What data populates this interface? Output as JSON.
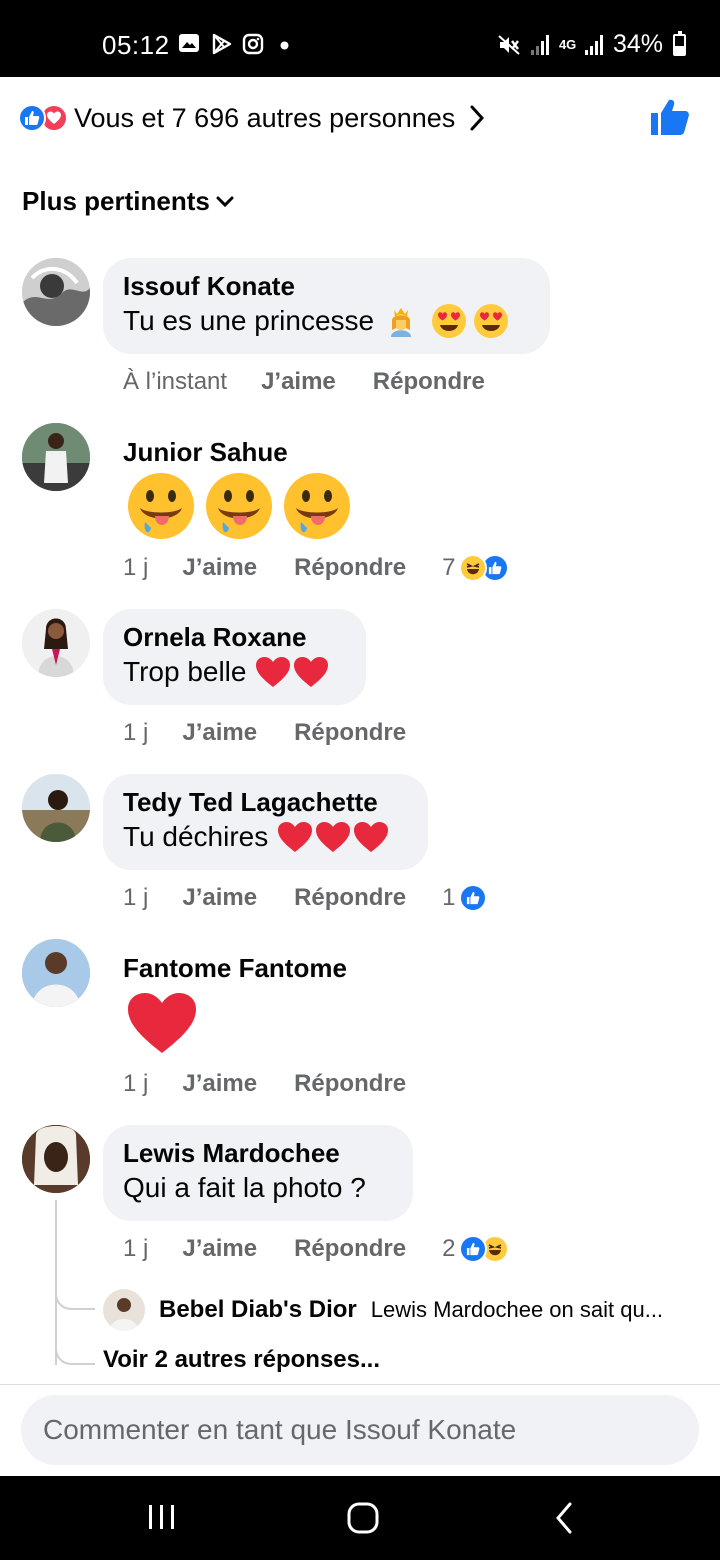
{
  "status_bar": {
    "time": "05:12",
    "battery": "34%",
    "network": "4G",
    "icons": [
      "gallery-icon",
      "play-store-icon",
      "instagram-icon",
      "dot-icon",
      "mute-icon",
      "signal-icon",
      "battery-icon"
    ]
  },
  "reactions": {
    "summary_text": "Vous et 7 696 autres personnes",
    "icons": [
      "like-icon",
      "love-icon"
    ],
    "colors": {
      "like": "#1877f2",
      "love": "#f33e58"
    }
  },
  "sort": {
    "label": "Plus pertinents"
  },
  "comments": [
    {
      "author": "Issouf Konate",
      "text": "Tu es une princesse",
      "emojis": [
        "princess",
        "heart-eyes",
        "heart-eyes"
      ],
      "time": "À l’instant",
      "like_label": "J’aime",
      "reply_label": "Répondre"
    },
    {
      "author": "Junior Sahue",
      "text": "",
      "emojis": [
        "drooling",
        "drooling",
        "drooling"
      ],
      "time": "1 j",
      "like_label": "J’aime",
      "reply_label": "Répondre",
      "reaction_count": "7",
      "reaction_icons": [
        "haha-icon",
        "like-icon"
      ]
    },
    {
      "author": "Ornela Roxane",
      "text": "Trop belle",
      "emojis": [
        "heart",
        "heart"
      ],
      "time": "1 j",
      "like_label": "J’aime",
      "reply_label": "Répondre"
    },
    {
      "author": "Tedy Ted Lagachette",
      "text": "Tu déchires",
      "emojis": [
        "heart",
        "heart",
        "heart"
      ],
      "time": "1 j",
      "like_label": "J’aime",
      "reply_label": "Répondre",
      "reaction_count": "1",
      "reaction_icons": [
        "like-icon"
      ]
    },
    {
      "author": "Fantome Fantome",
      "text": "",
      "emojis": [
        "heart"
      ],
      "time": "1 j",
      "like_label": "J’aime",
      "reply_label": "Répondre"
    },
    {
      "author": "Lewis Mardochee",
      "text": "Qui a fait la photo ?",
      "emojis": [],
      "time": "1 j",
      "like_label": "J’aime",
      "reply_label": "Répondre",
      "reaction_count": "2",
      "reaction_icons": [
        "like-icon",
        "haha-icon"
      ]
    }
  ],
  "reply_preview": {
    "author": "Bebel Diab's Dior",
    "text": "Lewis Mardochee on sait qu..."
  },
  "more_replies": "Voir 2 autres réponses...",
  "comment_input": {
    "placeholder": "Commenter en tant que Issouf Konate"
  }
}
